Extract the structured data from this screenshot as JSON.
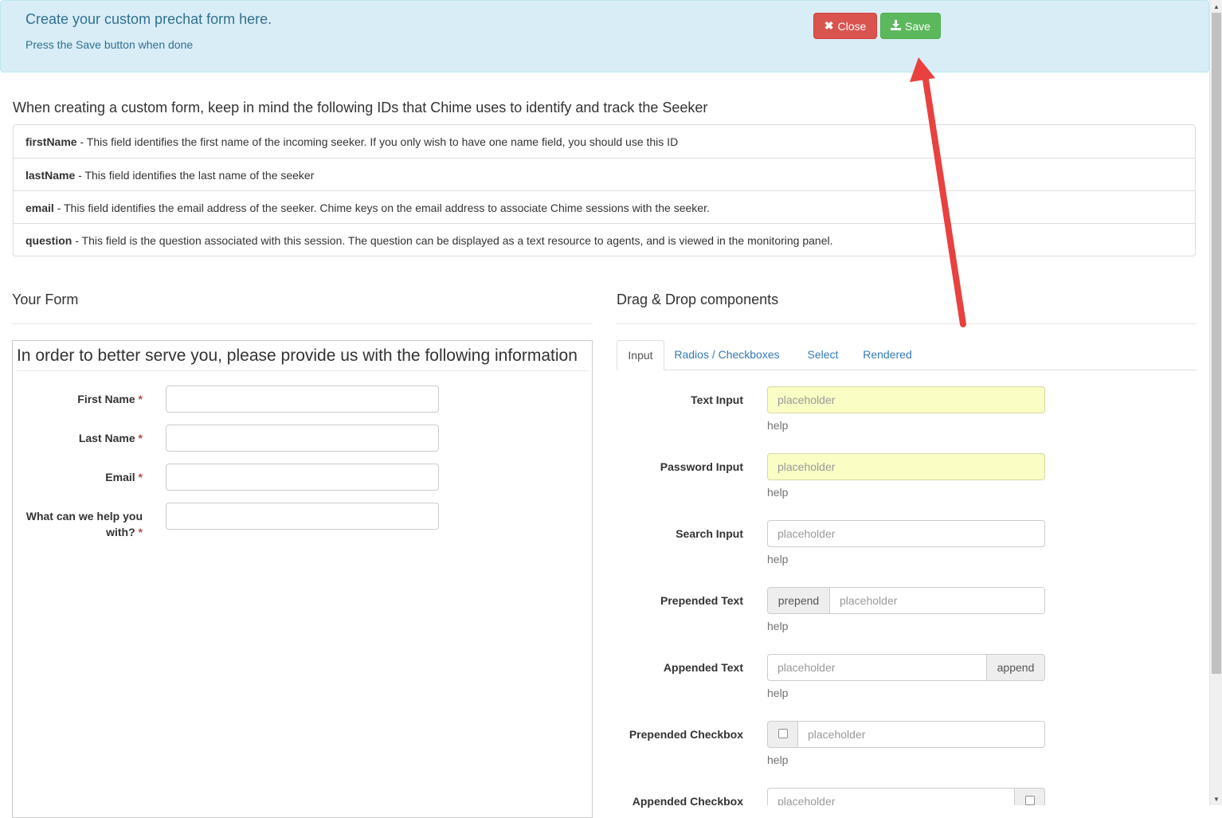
{
  "header": {
    "title": "Create your custom prechat form here.",
    "subtitle": "Press the Save button when done",
    "close_label": "Close",
    "save_label": "Save"
  },
  "ids_section": {
    "heading": "When creating a custom form, keep in mind the following IDs that Chime uses to identify and track the Seeker",
    "items": [
      {
        "id": "firstName",
        "text": " - This field identifies the first name of the incoming seeker. If you only wish to have one name field, you should use this ID"
      },
      {
        "id": "lastName",
        "text": " - This field identifies the last name of the seeker"
      },
      {
        "id": "email",
        "text": " - This field identifies the email address of the seeker. Chime keys on the email address to associate Chime sessions with the seeker."
      },
      {
        "id": "question",
        "text": " - This field is the question associated with this session. The question can be displayed as a text resource to agents, and is viewed in the monitoring panel."
      }
    ]
  },
  "your_form": {
    "title": "Your Form",
    "legend": "In order to better serve you, please provide us with the following information",
    "required_mark": "*",
    "fields": [
      {
        "label": "First Name",
        "value": ""
      },
      {
        "label": "Last Name",
        "value": ""
      },
      {
        "label": "Email",
        "value": ""
      },
      {
        "label_line1": "What can we help you",
        "label_line2": "with?",
        "value": ""
      }
    ]
  },
  "components": {
    "title": "Drag & Drop components",
    "tabs": [
      "Input",
      "Radios / Checkboxes",
      "Select",
      "Rendered"
    ],
    "active_tab": "Input",
    "items": [
      {
        "label": "Text Input",
        "placeholder": "placeholder",
        "help": "help"
      },
      {
        "label": "Password Input",
        "placeholder": "placeholder",
        "help": "help"
      },
      {
        "label": "Search Input",
        "placeholder": "placeholder",
        "help": "help"
      },
      {
        "label": "Prepended Text",
        "addon": "prepend",
        "placeholder": "placeholder",
        "help": "help"
      },
      {
        "label": "Appended Text",
        "addon": "append",
        "placeholder": "placeholder",
        "help": "help"
      },
      {
        "label": "Prepended Checkbox",
        "placeholder": "placeholder",
        "help": "help"
      },
      {
        "label": "Appended Checkbox",
        "placeholder": "placeholder"
      }
    ]
  },
  "icons": {
    "close": "times-icon",
    "save": "download-icon",
    "scroll_up": "scroll-up-arrow-icon",
    "scroll_down": "scroll-down-arrow-icon"
  },
  "colors": {
    "alert_bg": "#d9edf7",
    "alert_text": "#31708f",
    "close_button": "#d9534f",
    "save_button": "#5cb85c",
    "highlight_input": "#fafdc4",
    "annotation_arrow": "#e8413f",
    "link": "#337ab7"
  }
}
